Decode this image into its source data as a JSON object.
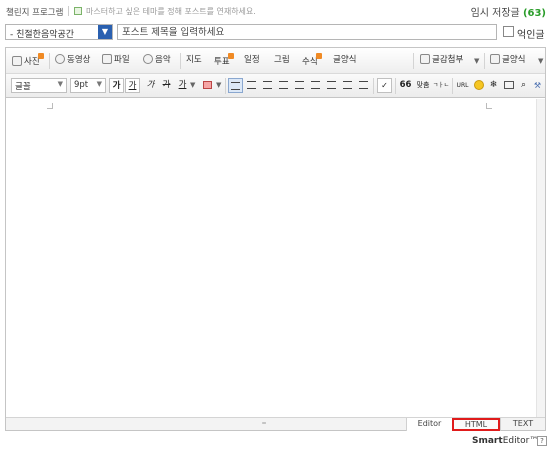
{
  "header": {
    "challenge_label": "챌린지 프로그램",
    "hint_text": "마스터하고 싶은 테마를 정해 포스트를 연재하세요.",
    "drafts_label": "임시 저장글",
    "drafts_count": "(63)"
  },
  "post": {
    "category": "- 친절한음악공간",
    "title_placeholder": "포스트 제목을 입력하세요",
    "pin_label": "억인글"
  },
  "toolbar1": {
    "photo": "사진",
    "video": "동영상",
    "file": "파일",
    "music": "음악",
    "map": "지도",
    "poll": "투표",
    "schedule": "일정",
    "draw": "그림",
    "formula": "수식",
    "writing_style": "글양식",
    "attach": "글감첨부",
    "template": "글양식"
  },
  "toolbar2": {
    "font": "글꼴",
    "size": "9pt",
    "bold": "가",
    "underline": "가",
    "italic": "가",
    "strike": "가",
    "color": "가",
    "quote": "66",
    "spell": "맞춤",
    "special": "ㄱㅏㄴ",
    "url": "URL"
  },
  "modes": {
    "editor": "Editor",
    "html": "HTML",
    "text": "TEXT"
  },
  "brand": {
    "smart": "Smart",
    "editor": "Editor™"
  }
}
